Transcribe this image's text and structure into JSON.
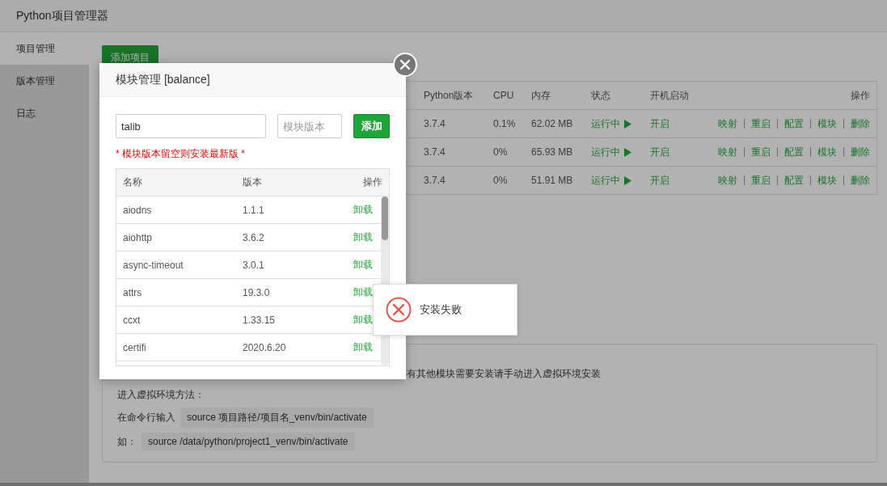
{
  "window": {
    "title": "Python项目管理器"
  },
  "sidebar": {
    "items": [
      {
        "label": "项目管理",
        "selected": true
      },
      {
        "label": "版本管理",
        "selected": false
      },
      {
        "label": "日志",
        "selected": false
      }
    ]
  },
  "toolbar": {
    "add_button": "添加项目"
  },
  "projects": {
    "columns": [
      "Python版本",
      "CPU",
      "内存",
      "状态",
      "开机启动",
      "操作"
    ],
    "rows": [
      {
        "python": "3.7.4",
        "cpu": "0.1%",
        "memory": "62.02 MB",
        "status": "运行中",
        "running": true,
        "autostart": "开启",
        "actions": [
          "映射",
          "重启",
          "配置",
          "模块",
          "删除"
        ]
      },
      {
        "python": "3.7.4",
        "cpu": "0%",
        "memory": "65.93 MB",
        "status": "运行中",
        "running": true,
        "autostart": "开启",
        "actions": [
          "映射",
          "重启",
          "配置",
          "模块",
          "删除"
        ]
      },
      {
        "python": "3.7.4",
        "cpu": "0%",
        "memory": "51.91 MB",
        "status": "运行中",
        "running": true,
        "autostart": "开启",
        "actions": [
          "映射",
          "重启",
          "配置",
          "模块",
          "删除"
        ]
      }
    ]
  },
  "note": {
    "lines": [
      {
        "kind": "partial",
        "text": "有其他模块需要安装请手动进入虚拟环境安装"
      },
      {
        "kind": "text",
        "text": "进入虚拟环境方法："
      },
      {
        "kind": "command",
        "label": "在命令行输入",
        "code": "source 项目路径/项目名_venv/bin/activate"
      },
      {
        "kind": "command",
        "label": "如：",
        "code": "source /data/python/project1_venv/bin/activate"
      }
    ]
  },
  "dialog": {
    "title": "模块管理 [balance]",
    "name_value": "talib",
    "version_placeholder": "模块版本",
    "add_button": "添加",
    "hint": "* 模块版本留空则安装最新版 *",
    "columns": [
      "名称",
      "版本",
      "操作"
    ],
    "modules": [
      {
        "name": "aiodns",
        "version": "1.1.1",
        "action": "卸载"
      },
      {
        "name": "aiohttp",
        "version": "3.6.2",
        "action": "卸载"
      },
      {
        "name": "async-timeout",
        "version": "3.0.1",
        "action": "卸载"
      },
      {
        "name": "attrs",
        "version": "19.3.0",
        "action": "卸载"
      },
      {
        "name": "ccxt",
        "version": "1.33.15",
        "action": "卸载"
      },
      {
        "name": "certifi",
        "version": "2020.6.20",
        "action": "卸载"
      }
    ]
  },
  "toast": {
    "kind": "error",
    "message": "安装失败"
  }
}
